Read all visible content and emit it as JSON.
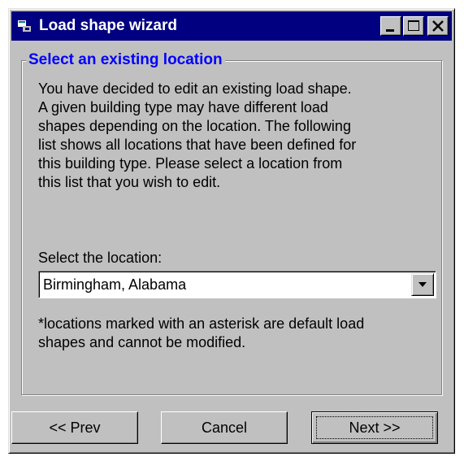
{
  "window": {
    "title": "Load shape wizard"
  },
  "titlebar_buttons": [
    "minimize",
    "maximize",
    "close"
  ],
  "group": {
    "legend": "Select an existing location"
  },
  "description": "You have decided to edit an existing load shape.\nA given building type may have different load\nshapes depending on the location.  The following\nlist shows all locations that have been defined for\nthis building type.  Please select a location from\nthis list that you wish to edit.",
  "location": {
    "label": "Select the location:",
    "selected": "Birmingham, Alabama"
  },
  "note": "*locations marked with an asterisk are default load\nshapes and cannot be modified.",
  "buttons": {
    "prev": "<< Prev",
    "cancel": "Cancel",
    "next": "Next >>"
  },
  "colors": {
    "titlebar": "#000080",
    "legend_text": "#0000ff",
    "face": "#c0c0c0"
  }
}
